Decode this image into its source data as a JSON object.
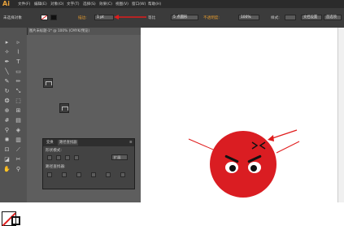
{
  "app": {
    "logo": "Ai"
  },
  "menu": [
    "文件(F)",
    "编辑(E)",
    "对象(O)",
    "文字(T)",
    "选择(S)",
    "效果(C)",
    "视图(V)",
    "窗口(W)",
    "帮助(H)"
  ],
  "control": {
    "selection_label": "未选择对象",
    "stroke_label": "描边:",
    "stroke_value": "1 pt",
    "uniform_label": "等比",
    "point_label": "5 点圆形",
    "opacity_label": "不透明度:",
    "opacity_value": "100%",
    "style_label": "样式:",
    "doc_setup": "文档设置",
    "prefs": "首选项"
  },
  "document": {
    "tab_title": "图片未标题-1* @ 100% (CMYK/预览)"
  },
  "panel": {
    "tab1": "变换",
    "tab2": "路径查找器",
    "section1": "形状模式:",
    "section2": "路径查找器:",
    "expand_label": "扩展"
  },
  "colors": {
    "face": "#da1d22",
    "accent": "#e39a2e"
  }
}
